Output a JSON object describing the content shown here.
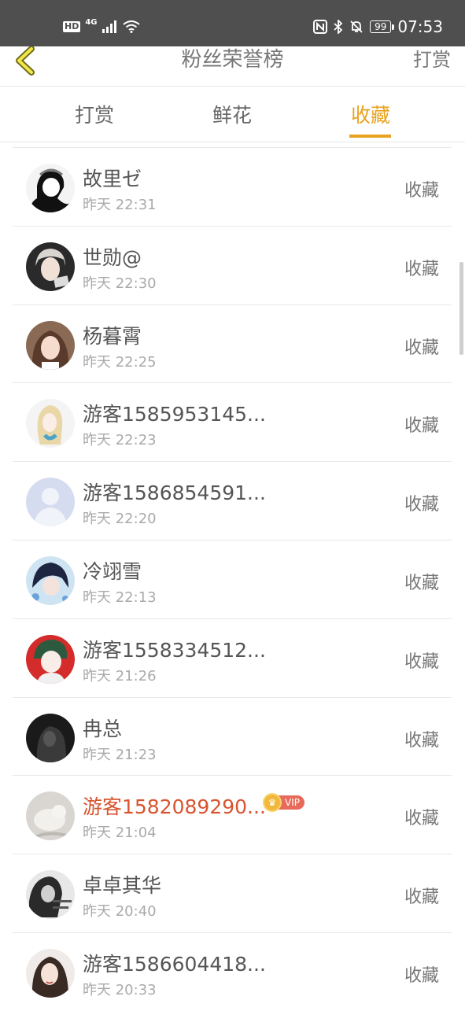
{
  "status_bar": {
    "hd": "HD",
    "network": "4G",
    "battery": "99",
    "time": "07:53"
  },
  "nav": {
    "title": "粉丝荣誉榜",
    "action": "打赏"
  },
  "tabs": [
    {
      "label": "打赏",
      "active": false
    },
    {
      "label": "鲜花",
      "active": false
    },
    {
      "label": "收藏",
      "active": true
    }
  ],
  "accent_color": "#e9a21f",
  "vip_name_color": "#d9542e",
  "list": [
    {
      "name": "故里ゼ",
      "time": "昨天 22:31",
      "action": "收藏"
    },
    {
      "name": "世勋@",
      "time": "昨天 22:30",
      "action": "收藏"
    },
    {
      "name": "杨暮霄",
      "time": "昨天 22:25",
      "action": "收藏"
    },
    {
      "name": "游客1585953145...",
      "time": "昨天 22:23",
      "action": "收藏"
    },
    {
      "name": "游客1586854591...",
      "time": "昨天 22:20",
      "action": "收藏"
    },
    {
      "name": "冷翊雪",
      "time": "昨天 22:13",
      "action": "收藏"
    },
    {
      "name": "游客1558334512...",
      "time": "昨天 21:26",
      "action": "收藏"
    },
    {
      "name": "冉总",
      "time": "昨天 21:23",
      "action": "收藏"
    },
    {
      "name": "游客1582089290...",
      "time": "昨天 21:04",
      "action": "收藏",
      "vip": "VIP"
    },
    {
      "name": "卓卓其华",
      "time": "昨天 20:40",
      "action": "收藏"
    },
    {
      "name": "游客1586604418...",
      "time": "昨天 20:33",
      "action": "收藏"
    }
  ]
}
